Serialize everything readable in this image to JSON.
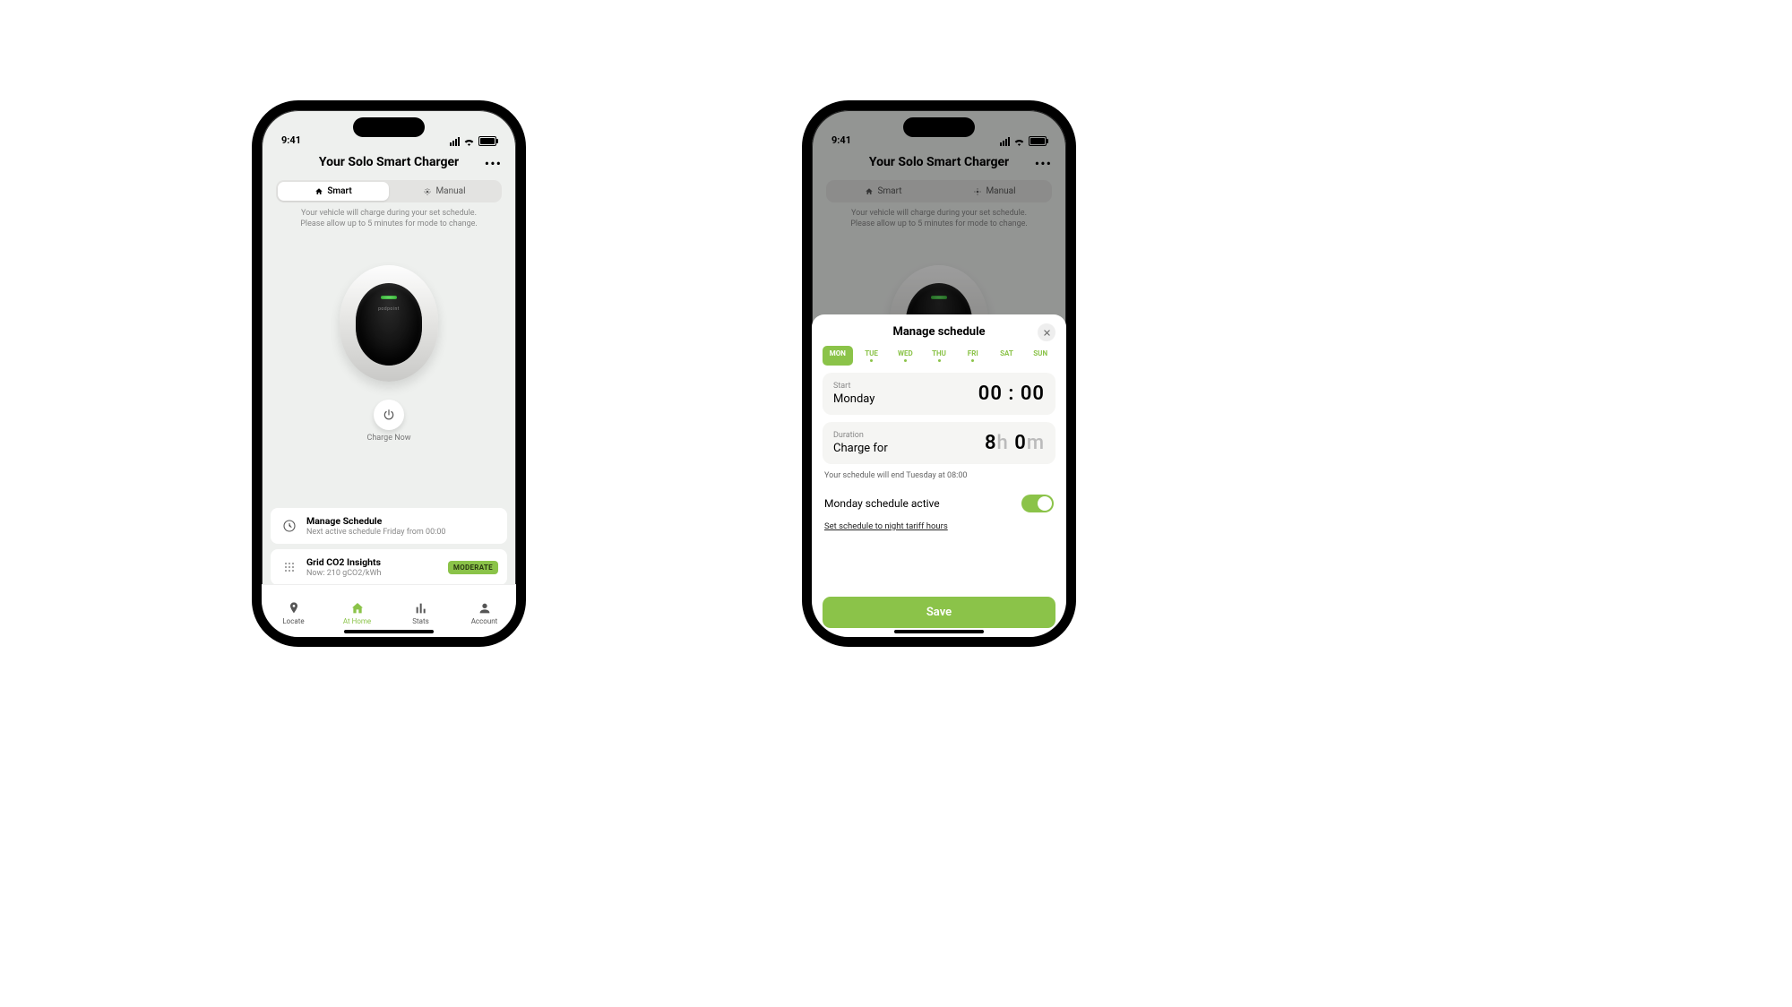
{
  "status": {
    "time": "9:41"
  },
  "header": {
    "title": "Your Solo Smart Charger"
  },
  "segmented": {
    "smart": "Smart",
    "manual": "Manual"
  },
  "hint": {
    "line1": "Your vehicle will charge during your set schedule.",
    "line2": "Please allow up to 5 minutes for mode to change."
  },
  "charge_now": "Charge Now",
  "cards": {
    "schedule": {
      "title": "Manage Schedule",
      "subtitle": "Next active schedule Friday from 00:00"
    },
    "co2": {
      "title": "Grid CO2 Insights",
      "subtitle": "Now: 210 gCO2/kWh",
      "badge": "MODERATE"
    }
  },
  "tabs": {
    "locate": "Locate",
    "home": "At Home",
    "stats": "Stats",
    "account": "Account"
  },
  "sheet": {
    "title": "Manage schedule",
    "days": [
      {
        "label": "MON",
        "selected": true,
        "dot": false
      },
      {
        "label": "TUE",
        "selected": false,
        "dot": true
      },
      {
        "label": "WED",
        "selected": false,
        "dot": true
      },
      {
        "label": "THU",
        "selected": false,
        "dot": true
      },
      {
        "label": "FRI",
        "selected": false,
        "dot": true
      },
      {
        "label": "SAT",
        "selected": false,
        "dot": false
      },
      {
        "label": "SUN",
        "selected": false,
        "dot": false
      }
    ],
    "start_label": "Start",
    "start_day": "Monday",
    "start_time": "00 : 00",
    "duration_label": "Duration",
    "duration_desc": "Charge for",
    "duration_h": "8",
    "duration_h_unit": "h",
    "duration_m": "0",
    "duration_m_unit": "m",
    "end_note": "Your schedule will end Tuesday at 08:00",
    "toggle_label": "Monday schedule active",
    "link": "Set schedule to night tariff hours",
    "save": "Save"
  }
}
